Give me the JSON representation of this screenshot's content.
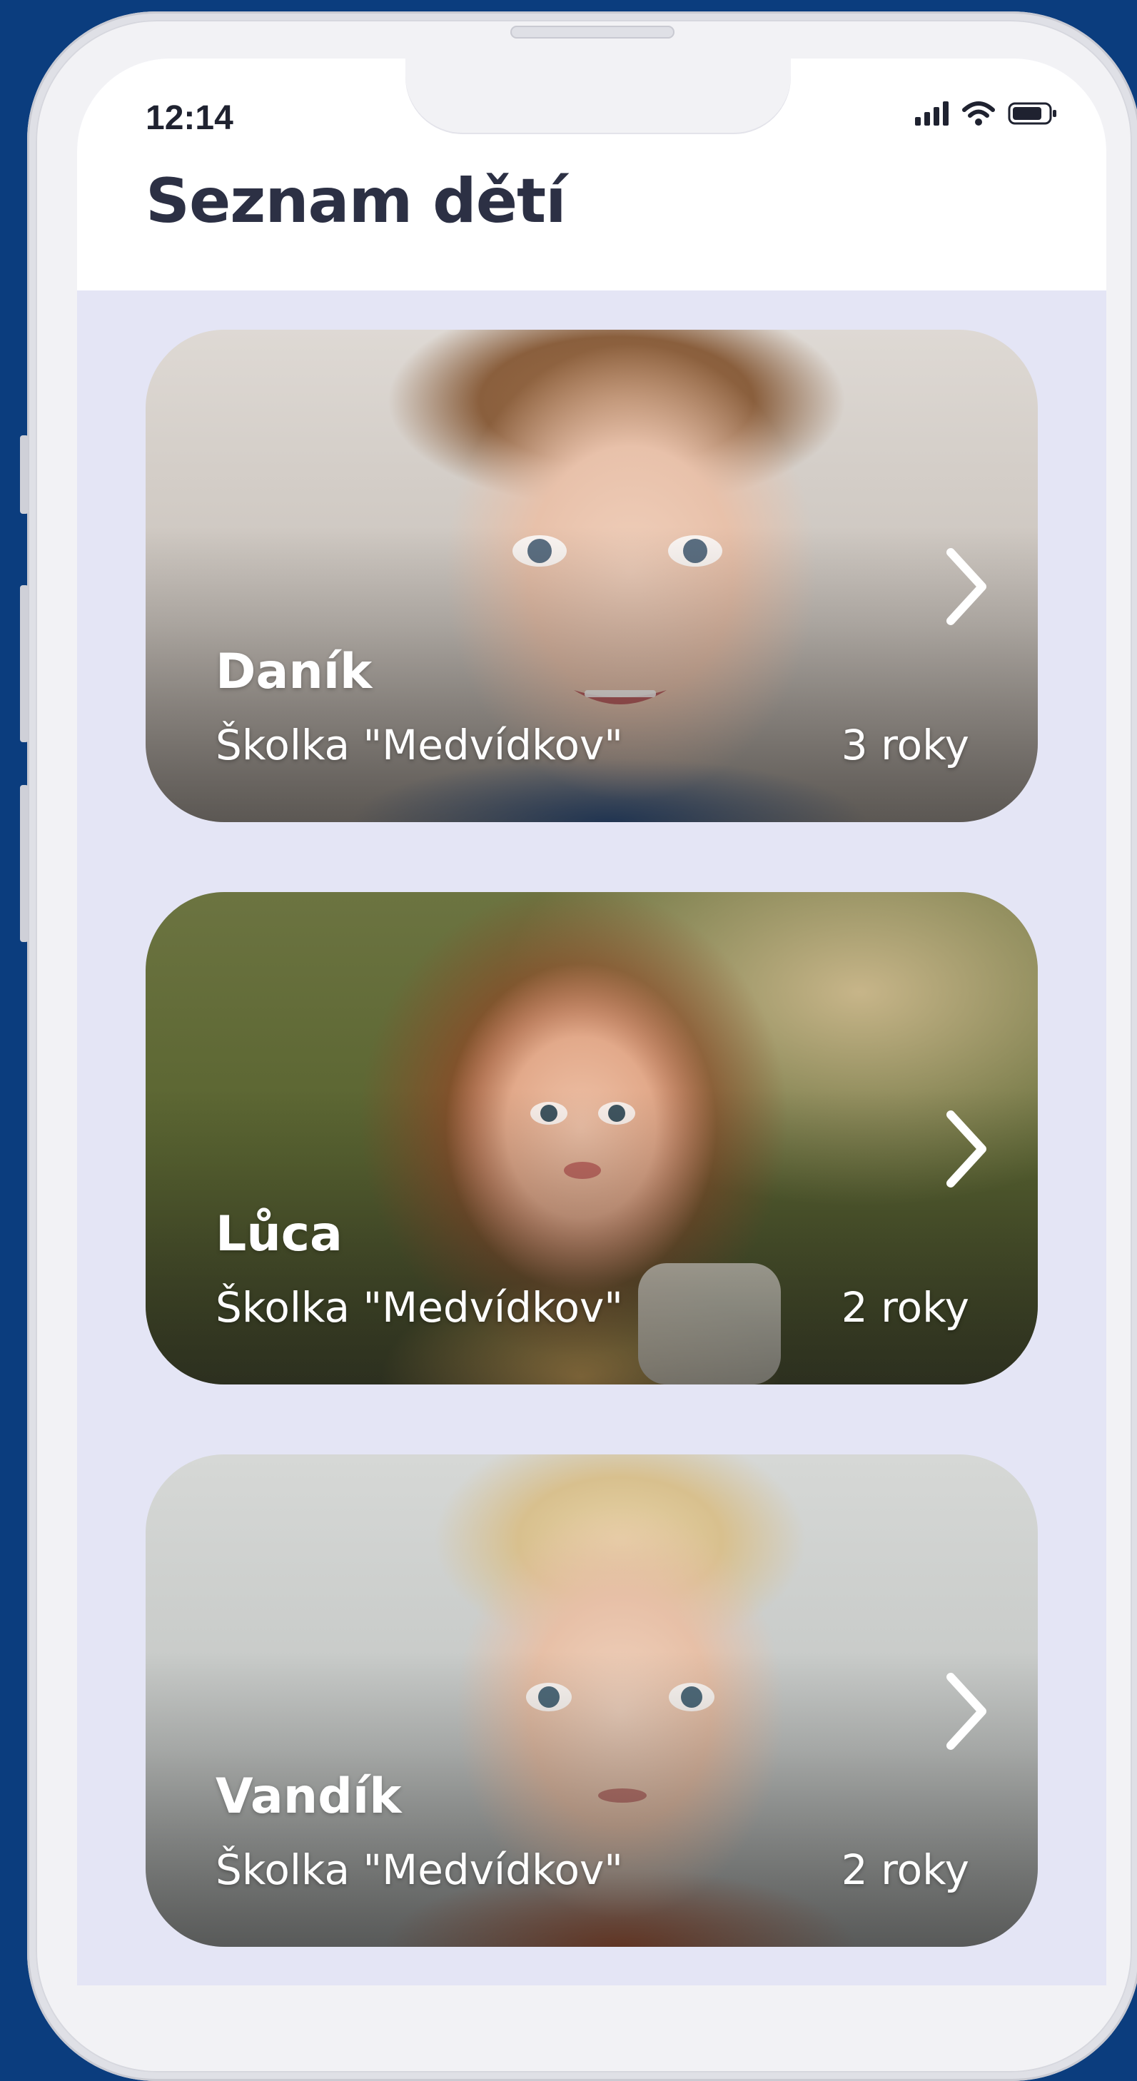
{
  "status_bar": {
    "time": "12:14",
    "icons": [
      "signal-icon",
      "wifi-icon",
      "battery-icon"
    ]
  },
  "header": {
    "title": "Seznam dětí"
  },
  "children": [
    {
      "name": "Daník",
      "school": "Školka \"Medvídkov\"",
      "age": "3 roky",
      "photo_tone": "#c8bdb1"
    },
    {
      "name": "Lůca",
      "school": "Školka \"Medvídkov\"",
      "age": "2 roky",
      "photo_tone": "#6f7346"
    },
    {
      "name": "Vandík",
      "school": "Školka \"Medvídkov\"",
      "age": "2 roky",
      "photo_tone": "#c9cbca"
    }
  ],
  "colors": {
    "background": "#0b3d7e",
    "screen_background": "#e4e5f5",
    "title_text": "#2c3044",
    "card_text": "#ffffff"
  }
}
